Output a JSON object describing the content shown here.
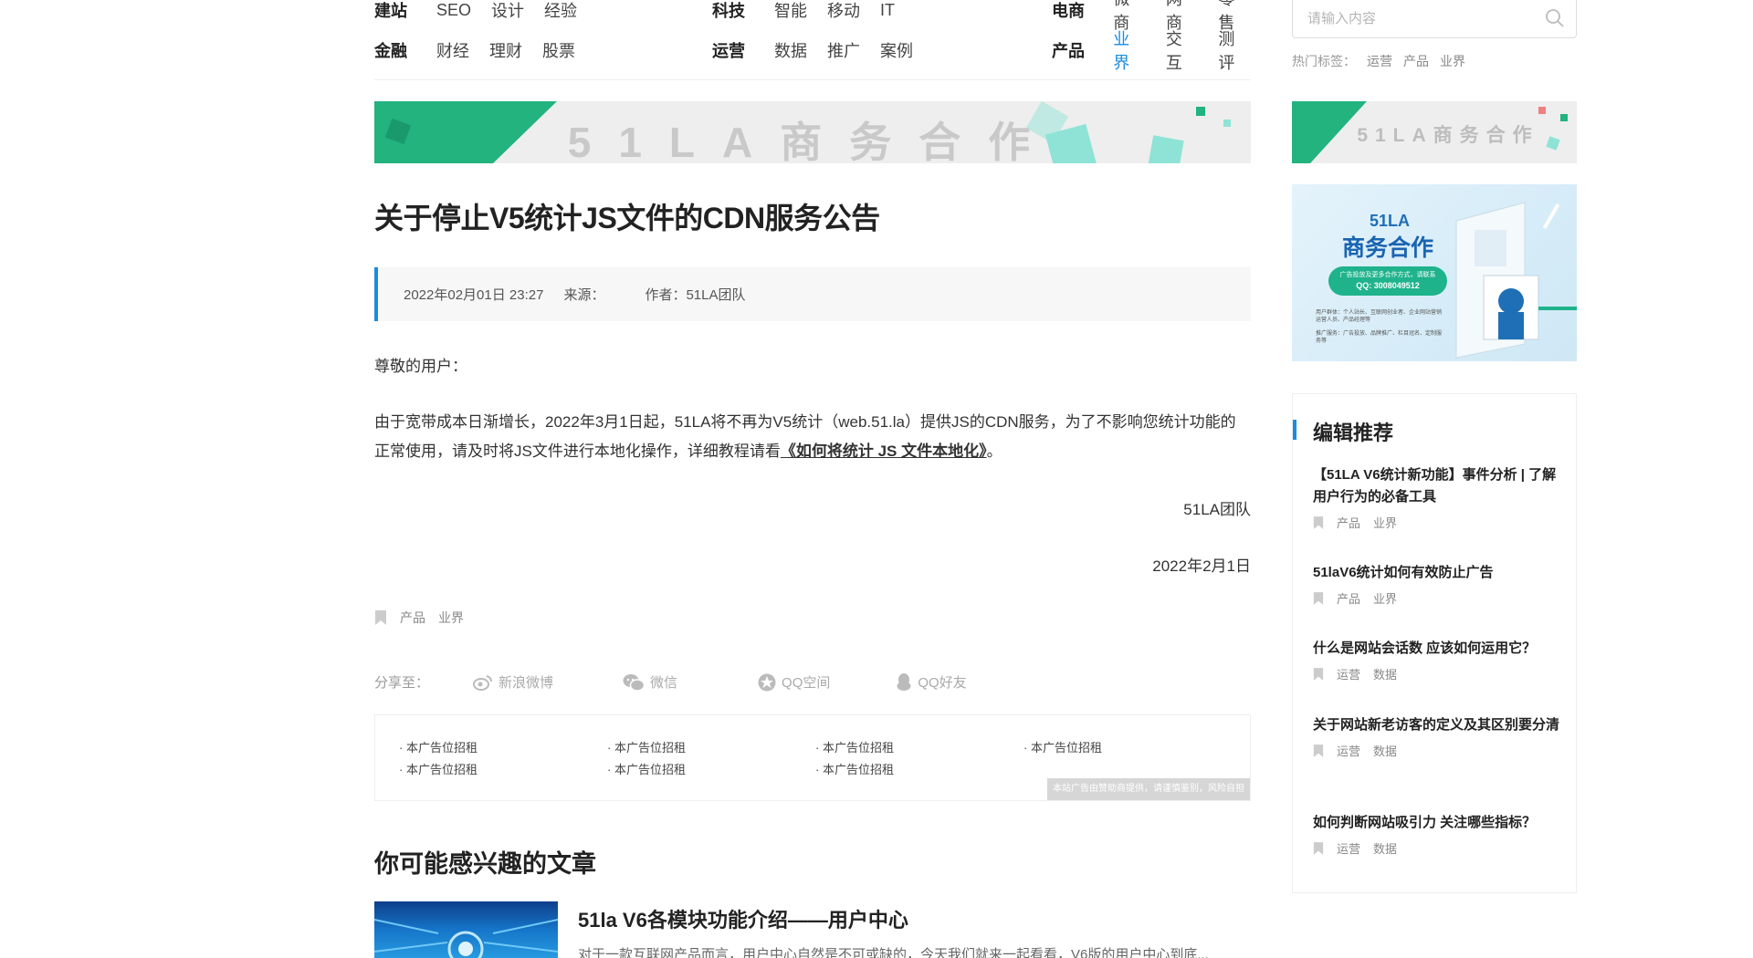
{
  "nav": {
    "groups": [
      {
        "head": "建站",
        "links": [
          "SEO",
          "设计",
          "经验"
        ]
      },
      {
        "head": "科技",
        "links": [
          "智能",
          "移动",
          "IT"
        ]
      },
      {
        "head": "电商",
        "links": [
          "微商",
          "网商",
          "零售"
        ]
      },
      {
        "head": "金融",
        "links": [
          "财经",
          "理财",
          "股票"
        ]
      },
      {
        "head": "运营",
        "links": [
          "数据",
          "推广",
          "案例"
        ]
      },
      {
        "head": "产品",
        "links": [
          "业界",
          "交互",
          "测评"
        ]
      }
    ]
  },
  "search": {
    "placeholder": "请输入内容"
  },
  "hot": {
    "label": "热门标签：",
    "tags": [
      "运营",
      "产品",
      "业界"
    ]
  },
  "banner": {
    "text": "51LA商务合作"
  },
  "promo": {
    "brand": "51LA",
    "headline": "商务合作",
    "contact_hint": "广告投放及更多合作方式，请联系",
    "qq": "QQ: 3008049512",
    "line1": "用户群体：个人站长、互联网创业者、企业网站营销运营人员、产品经理等",
    "line2": "推广服务：广告投放、品牌推广、栏目冠名、定制服务等"
  },
  "article": {
    "title": "关于停止V5统计JS文件的CDN服务公告",
    "date": "2022年02月01日 23:27",
    "source_label": "来源：",
    "author": "作者：51LA团队",
    "greeting": "尊敬的用户：",
    "para1": "由于宽带成本日渐增长，2022年3月1日起，51LA将不再为V5统计（web.51.la）提供JS的CDN服务，为了不影响您统计功能的正常使用，请及时将JS文件进行本地化操作，详细教程请看",
    "tutorial_link": "《如何将统计 JS 文件本地化》",
    "period": "。",
    "sign": "51LA团队",
    "sign_date": "2022年2月1日",
    "tags": [
      "产品",
      "业界"
    ]
  },
  "share": {
    "label": "分享至：",
    "weibo": "新浪微博",
    "wechat": "微信",
    "qzone": "QQ空间",
    "qq": "QQ好友"
  },
  "ads": {
    "items": [
      "· 本广告位招租",
      "· 本广告位招租",
      "· 本广告位招租",
      "· 本广告位招租",
      "· 本广告位招租",
      "· 本广告位招租",
      "· 本广告位招租"
    ],
    "note": "本站广告由赞助商提供，请谨慎鉴别，风险自担"
  },
  "related": {
    "heading": "你可能感兴趣的文章",
    "items": [
      {
        "title": "51la V6各模块功能介绍——用户中心",
        "desc": "对于一款互联网产品而言，用户中心自然是不可或缺的，今天我们就来一起看看，V6版的用户中心到底..."
      }
    ]
  },
  "picks": {
    "heading": "编辑推荐",
    "items": [
      {
        "title": "【51LA V6统计新功能】事件分析 | 了解用户行为的必备工具",
        "tags": [
          "产品",
          "业界"
        ]
      },
      {
        "title": "51laV6统计如何有效防止广告",
        "tags": [
          "产品",
          "业界"
        ]
      },
      {
        "title": "什么是网站会话数 应该如何运用它？",
        "tags": [
          "运营",
          "数据"
        ]
      },
      {
        "title": "关于网站新老访客的定义及其区别要分清",
        "tags": [
          "运营",
          "数据"
        ]
      },
      {
        "title": "如何判断网站吸引力 关注哪些指标？",
        "tags": [
          "运营",
          "数据"
        ]
      }
    ]
  },
  "colors": {
    "accent": "#1a8ce0",
    "banner_green": "#22b37f",
    "banner_teal": "#8ee3d6"
  }
}
